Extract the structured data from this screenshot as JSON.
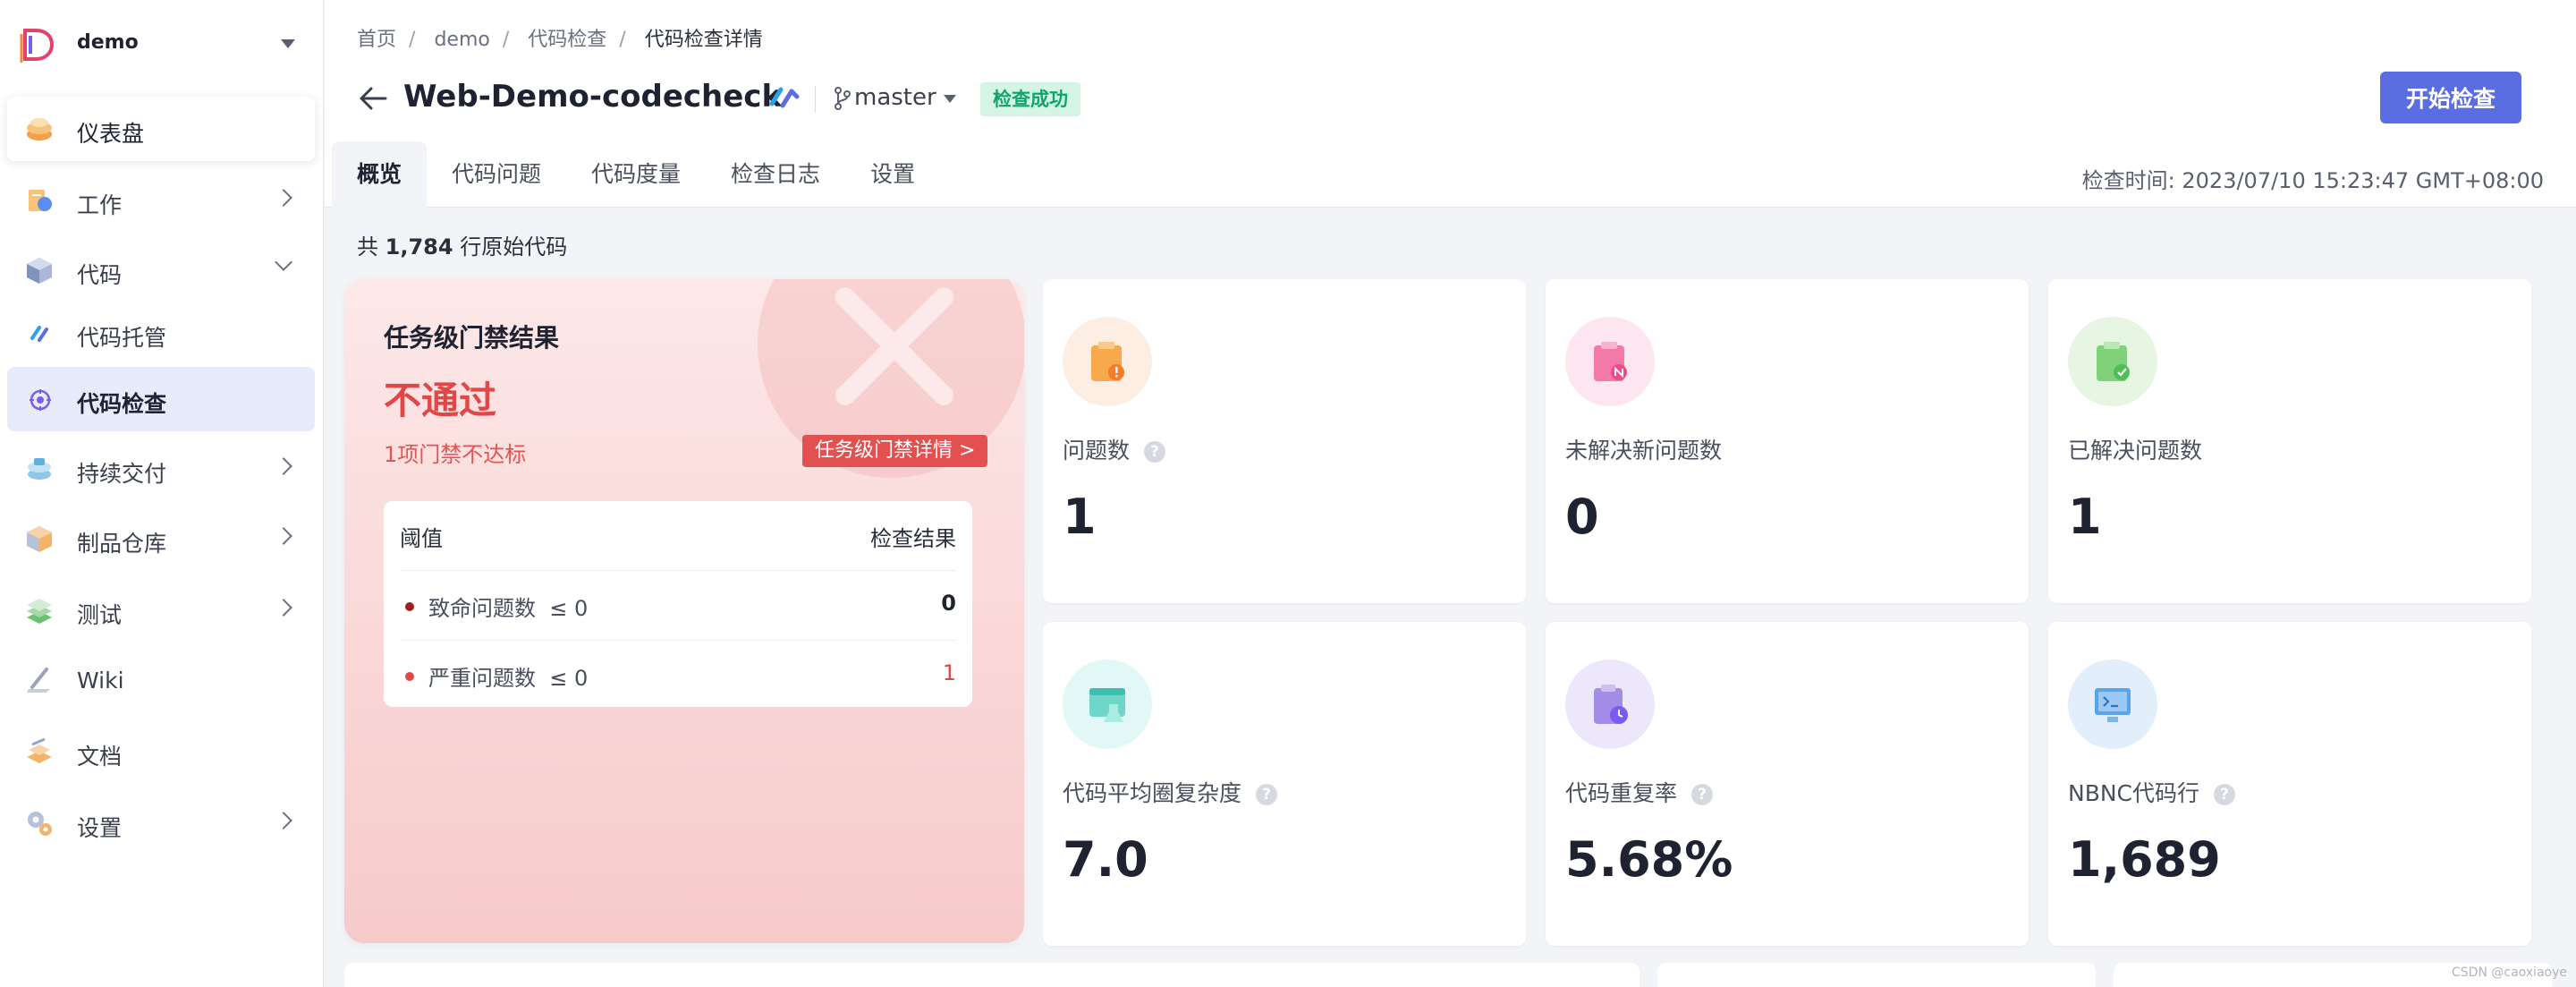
{
  "sidebar": {
    "project": "demo",
    "items": [
      {
        "label": "仪表盘"
      },
      {
        "label": "工作"
      },
      {
        "label": "代码"
      },
      {
        "label": "代码托管"
      },
      {
        "label": "代码检查"
      },
      {
        "label": "持续交付"
      },
      {
        "label": "制品仓库"
      },
      {
        "label": "测试"
      },
      {
        "label": "Wiki"
      },
      {
        "label": "文档"
      },
      {
        "label": "设置"
      }
    ]
  },
  "breadcrumb": [
    "首页",
    "demo",
    "代码检查",
    "代码检查详情"
  ],
  "header": {
    "title": "Web-Demo-codecheck",
    "branch": "master",
    "status": "检查成功",
    "start_button": "开始检查"
  },
  "tabs": [
    "概览",
    "代码问题",
    "代码度量",
    "检查日志",
    "设置"
  ],
  "check_time": "检查时间: 2023/07/10 15:23:47 GMT+08:00",
  "summary": {
    "prefix": "共 ",
    "lines": "1,784",
    "suffix": " 行原始代码"
  },
  "gate": {
    "title": "任务级门禁结果",
    "result": "不通过",
    "sub": "1项门禁不达标",
    "detail_button": "任务级门禁详情 >",
    "table": {
      "col_threshold": "阈值",
      "col_result": "检查结果",
      "rows": [
        {
          "name": "致命问题数",
          "threshold": "≤ 0",
          "value": "0",
          "dot_color": "#a31d1d"
        },
        {
          "name": "严重问题数",
          "threshold": "≤ 0",
          "value": "1",
          "dot_color": "#e04848"
        }
      ]
    }
  },
  "metrics": [
    {
      "label": "问题数",
      "value": "1",
      "help": "?"
    },
    {
      "label": "未解决新问题数",
      "value": "0"
    },
    {
      "label": "已解决问题数",
      "value": "1"
    },
    {
      "label": "代码平均圈复杂度",
      "value": "7.0",
      "help": "?"
    },
    {
      "label": "代码重复率",
      "value": "5.68%",
      "help": "?"
    },
    {
      "label": "NBNC代码行",
      "value": "1,689",
      "help": "?"
    }
  ],
  "watermark": "CSDN @caoxiaoye",
  "colors": {
    "accent": "#5b6ee1",
    "fail": "#e04848",
    "success": "#10a569"
  }
}
